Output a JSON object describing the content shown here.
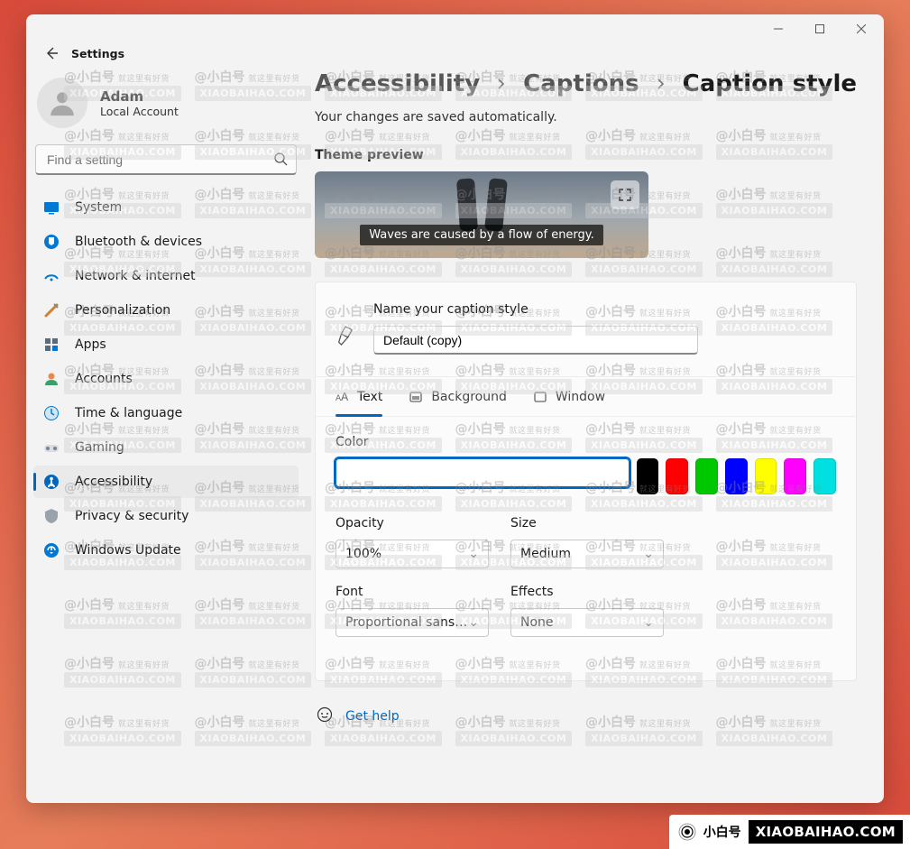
{
  "window": {
    "app_title": "Settings"
  },
  "user": {
    "name": "Adam",
    "type": "Local Account"
  },
  "search": {
    "placeholder": "Find a setting"
  },
  "nav": {
    "items": [
      {
        "label": "System"
      },
      {
        "label": "Bluetooth & devices"
      },
      {
        "label": "Network & internet"
      },
      {
        "label": "Personalization"
      },
      {
        "label": "Apps"
      },
      {
        "label": "Accounts"
      },
      {
        "label": "Time & language"
      },
      {
        "label": "Gaming"
      },
      {
        "label": "Accessibility"
      },
      {
        "label": "Privacy & security"
      },
      {
        "label": "Windows Update"
      }
    ],
    "active_index": 8
  },
  "breadcrumbs": {
    "a": "Accessibility",
    "b": "Captions",
    "c": "Caption style"
  },
  "save_note": "Your changes are saved automatically.",
  "preview": {
    "title": "Theme preview",
    "caption": "Waves are caused by a flow of energy."
  },
  "name": {
    "label": "Name your caption style",
    "value": "Default (copy)"
  },
  "tabs": {
    "text": "Text",
    "background": "Background",
    "window": "Window",
    "active": "text"
  },
  "text": {
    "color_label": "Color",
    "colors": [
      "#ffffff",
      "#000000",
      "#ff0000",
      "#00c800",
      "#0000ff",
      "#ffff00",
      "#ff00ff",
      "#00e0e0"
    ],
    "selected_color_index": 0,
    "opacity_label": "Opacity",
    "opacity": "100%",
    "size_label": "Size",
    "size": "Medium",
    "font_label": "Font",
    "font": "Proportional sans s…",
    "effects_label": "Effects",
    "effects": "None"
  },
  "help": {
    "label": "Get help"
  },
  "watermark": {
    "line_a": "@小白号",
    "sub": "就这里有好货",
    "line_b": "XIAOBAIHAO.COM"
  },
  "badge": {
    "brand": "小白号",
    "url": "XIAOBAIHAO.COM"
  }
}
